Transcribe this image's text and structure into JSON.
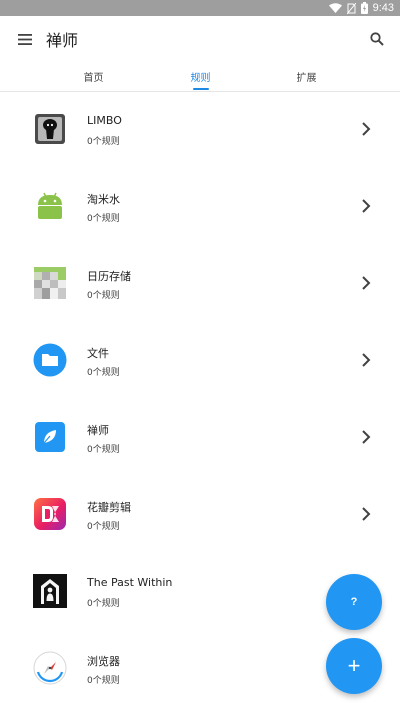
{
  "status_bar": {
    "time": "9:43"
  },
  "app_bar": {
    "title": "禅师"
  },
  "tabs": [
    {
      "label": "首页",
      "active": false
    },
    {
      "label": "规则",
      "active": true
    },
    {
      "label": "扩展",
      "active": false
    }
  ],
  "apps": [
    {
      "name": "LIMBO",
      "rules": "0个规则",
      "icon": "limbo-icon"
    },
    {
      "name": "淘米水",
      "rules": "0个规则",
      "icon": "android-icon"
    },
    {
      "name": "日历存储",
      "rules": "0个规则",
      "icon": "calendar-storage-icon"
    },
    {
      "name": "文件",
      "rules": "0个规则",
      "icon": "files-icon"
    },
    {
      "name": "禅师",
      "rules": "0个规则",
      "icon": "zen-master-icon"
    },
    {
      "name": "花瓣剪辑",
      "rules": "0个规则",
      "icon": "petal-edit-icon"
    },
    {
      "name": "The Past Within",
      "rules": "0个规则",
      "icon": "the-past-within-icon"
    },
    {
      "name": "浏览器",
      "rules": "0个规则",
      "icon": "browser-icon"
    }
  ],
  "fabs": {
    "help_label": "?",
    "add_label": "+"
  },
  "colors": {
    "accent": "#1e88e5",
    "fab": "#2196f3",
    "status_bar": "#9e9e9e"
  }
}
